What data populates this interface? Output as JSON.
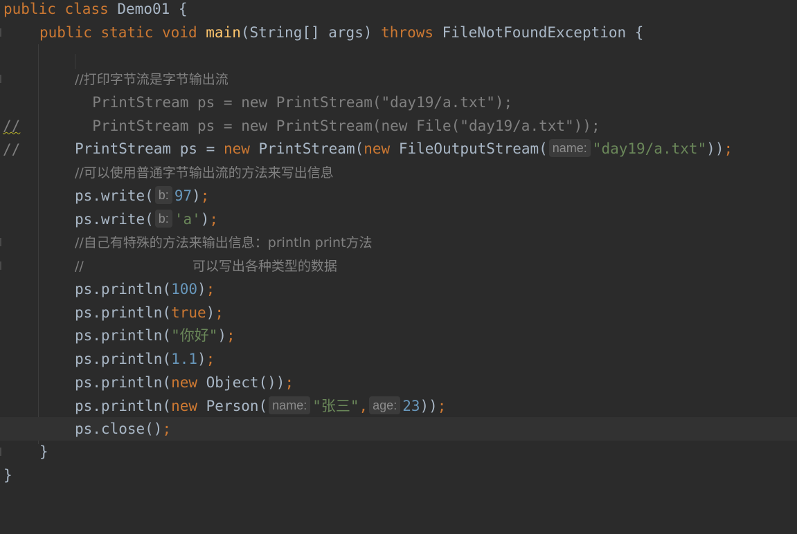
{
  "editor": {
    "class_decl": {
      "kw1": "public",
      "kw2": "class",
      "name": "Demo01",
      "brace": "{"
    },
    "method_decl": {
      "kw1": "public",
      "kw2": "static",
      "kw3": "void",
      "name": "main",
      "params": "(String[] args) ",
      "throws": "throws",
      "exception": "FileNotFoundException {"
    },
    "comment_print_stream": "//打印字节流是字节输出流",
    "gutter_comment_1": "//",
    "gutter_comment_2": "//",
    "commented_line_1": "  PrintStream ps = new PrintStream(\"day19/a.txt\");",
    "commented_line_2": "  PrintStream ps = new PrintStream(new File(\"day19/a.txt\"));",
    "ps_decl": {
      "type": "PrintStream ps = ",
      "new1": "new",
      "ctor": " PrintStream(",
      "new2": "new",
      "ctor2": " FileOutputStream(",
      "hint": "name:",
      "arg": "\"day19/a.txt\"",
      "close": "))",
      "semi": ";"
    },
    "comment_write": "//可以使用普通字节输出流的方法来写出信息",
    "write_1": {
      "call": "ps.write(",
      "hint": "b:",
      "arg": "97",
      "close": ")",
      "semi": ";"
    },
    "write_2": {
      "call": "ps.write(",
      "hint": "b:",
      "arg": "'a'",
      "close": ")",
      "semi": ";"
    },
    "comment_special_1": "//自己有特殊的方法来输出信息：println print方法",
    "comment_special_2": "//                          可以写出各种类型的数据",
    "println_1": {
      "call": "ps.println(",
      "arg": "100",
      "close": ")",
      "semi": ";"
    },
    "println_2": {
      "call": "ps.println(",
      "arg": "true",
      "close": ")",
      "semi": ";"
    },
    "println_3": {
      "call": "ps.println(",
      "arg": "\"你好\"",
      "close": ")",
      "semi": ";"
    },
    "println_4": {
      "call": "ps.println(",
      "arg": "1.1",
      "close": ")",
      "semi": ";"
    },
    "println_5": {
      "call": "ps.println(",
      "new": "new",
      "rest": " Object())",
      "semi": ";"
    },
    "println_6": {
      "call": "ps.println(",
      "new": "new",
      "ctor": " Person(",
      "hint1": "name:",
      "arg1": "\"张三\"",
      "comma": ",",
      "hint2": "age:",
      "arg2": "23",
      "close": "))",
      "semi": ";"
    },
    "close_call": {
      "call": "ps.close()",
      "semi": ";"
    },
    "method_close": "}",
    "class_close": "}"
  },
  "colors": {
    "background": "#2b2b2b",
    "keyword": "#cc7832",
    "method": "#ffc66d",
    "string": "#6a8759",
    "number": "#6897bb",
    "comment": "#808080",
    "text": "#a9b7c6",
    "current_line": "#323232"
  }
}
